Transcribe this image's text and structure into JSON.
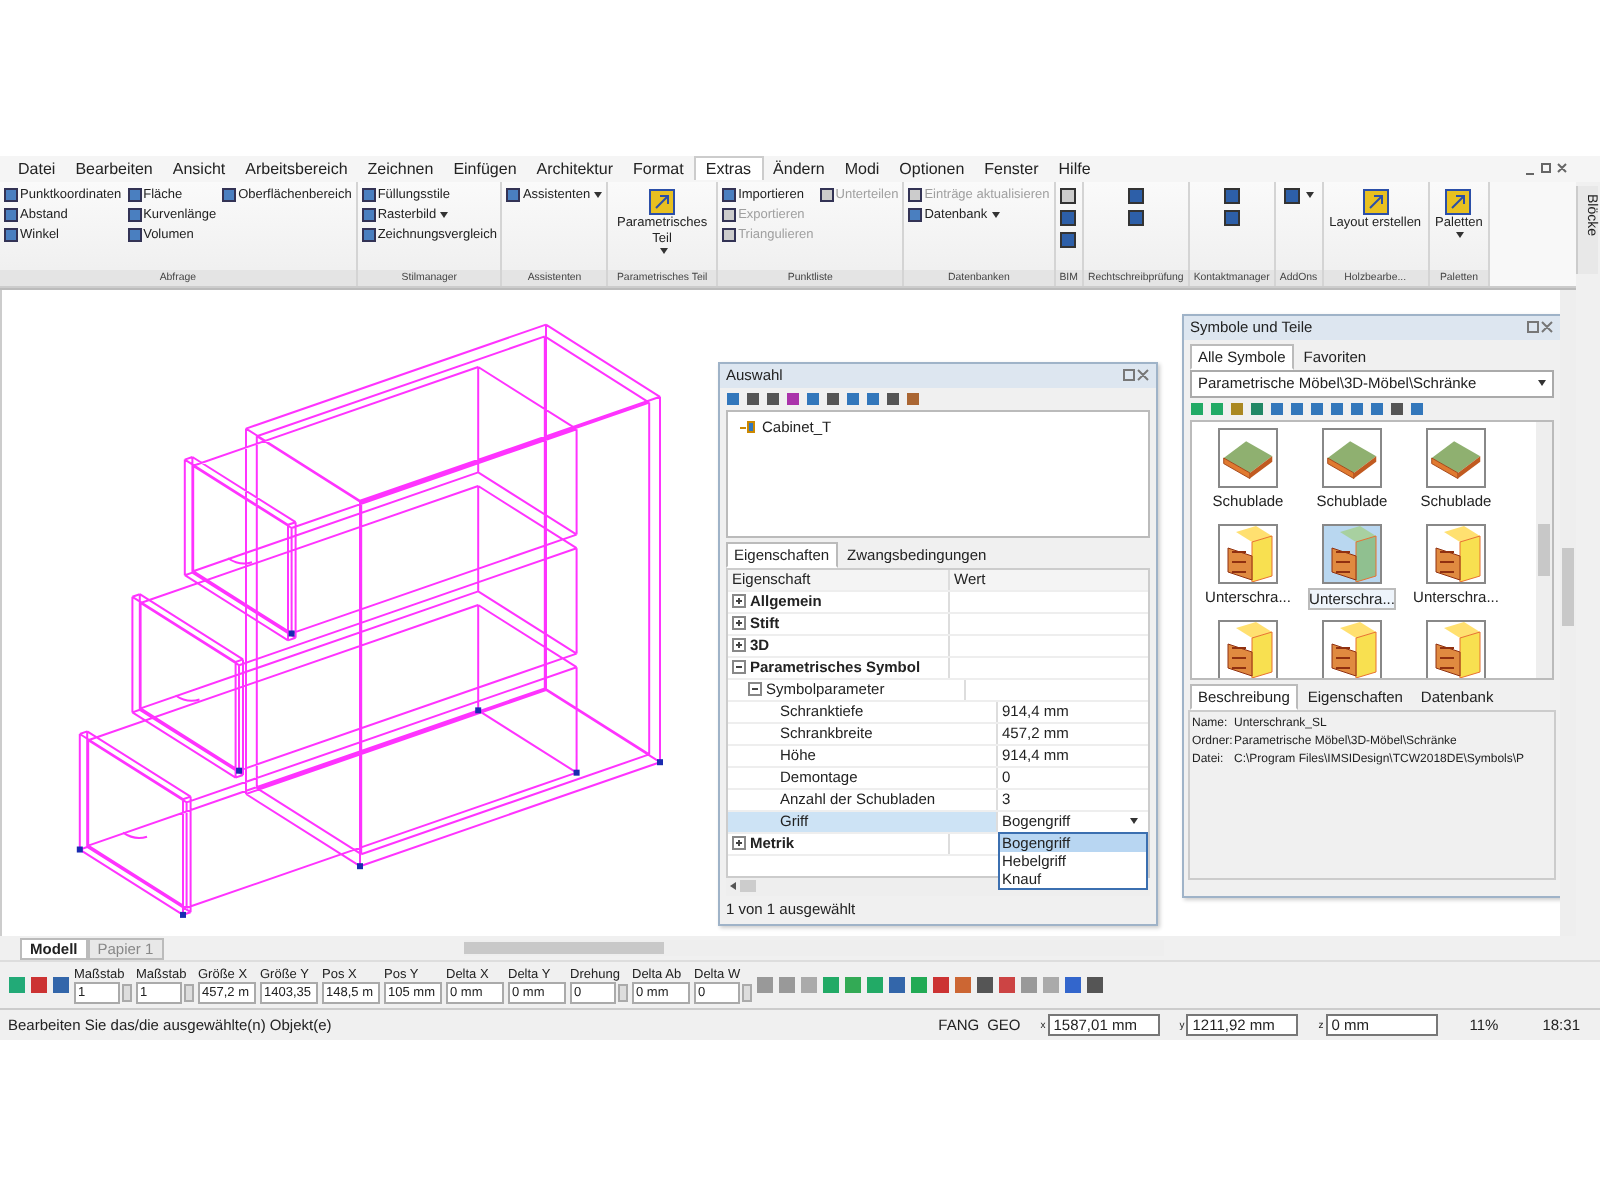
{
  "menu": [
    {
      "label": "Datei",
      "selected": false
    },
    {
      "label": "Bearbeiten",
      "selected": false
    },
    {
      "label": "Ansicht",
      "selected": false
    },
    {
      "label": "Arbeitsbereich",
      "selected": false
    },
    {
      "label": "Zeichnen",
      "selected": false
    },
    {
      "label": "Einfügen",
      "selected": false
    },
    {
      "label": "Architektur",
      "selected": false
    },
    {
      "label": "Format",
      "selected": false
    },
    {
      "label": "Extras",
      "selected": true
    },
    {
      "label": "Ändern",
      "selected": false
    },
    {
      "label": "Modi",
      "selected": false
    },
    {
      "label": "Optionen",
      "selected": false
    },
    {
      "label": "Fenster",
      "selected": false
    },
    {
      "label": "Hilfe",
      "selected": false
    }
  ],
  "ribbon": [
    {
      "label": "Abfrage",
      "kind": "list",
      "items": [
        {
          "label": "Punktkoordinaten",
          "disabled": false
        },
        {
          "label": "Abstand",
          "disabled": false
        },
        {
          "label": "Winkel",
          "disabled": false
        },
        {
          "label": "Fläche",
          "disabled": false
        },
        {
          "label": "Kurvenlänge",
          "disabled": false
        },
        {
          "label": "Volumen",
          "disabled": false
        },
        {
          "label": "Oberflächenbereich",
          "disabled": false
        }
      ]
    },
    {
      "label": "Stilmanager",
      "kind": "list",
      "items": [
        {
          "label": "Füllungsstile",
          "disabled": false
        },
        {
          "label": "Rasterbild",
          "disabled": false,
          "dropdown": true
        },
        {
          "label": "Zeichnungsvergleich",
          "disabled": false
        }
      ]
    },
    {
      "label": "Assistenten",
      "kind": "list",
      "items": [
        {
          "label": "Assistenten",
          "disabled": false,
          "dropdown": true
        }
      ]
    },
    {
      "label": "Parametrisches Teil",
      "kind": "large",
      "items": [
        {
          "label": "Parametrisches Teil",
          "disabled": false,
          "dropdown": true
        }
      ]
    },
    {
      "label": "Punktliste",
      "kind": "list",
      "items": [
        {
          "label": "Importieren",
          "disabled": false
        },
        {
          "label": "Exportieren",
          "disabled": true
        },
        {
          "label": "Triangulieren",
          "disabled": true
        },
        {
          "label": "Unterteilen",
          "disabled": true
        }
      ]
    },
    {
      "label": "Datenbanken",
      "kind": "list",
      "items": [
        {
          "label": "Einträge aktualisieren",
          "disabled": true
        },
        {
          "label": "Datenbank",
          "disabled": false,
          "dropdown": true
        }
      ]
    },
    {
      "label": "BIM",
      "kind": "icons",
      "items": [
        {
          "disabled": true
        },
        {
          "disabled": false
        },
        {
          "disabled": false
        }
      ]
    },
    {
      "label": "Rechtschreibprüfung",
      "kind": "icons",
      "items": [
        {
          "disabled": false
        },
        {
          "disabled": false
        }
      ]
    },
    {
      "label": "Kontaktmanager",
      "kind": "icons",
      "items": [
        {
          "disabled": false
        },
        {
          "disabled": false
        }
      ]
    },
    {
      "label": "AddOns",
      "kind": "icons",
      "items": [
        {
          "disabled": false,
          "dropdown": true
        }
      ]
    },
    {
      "label": "Holzbearbe...",
      "kind": "large",
      "items": [
        {
          "label": "Layout erstellen",
          "disabled": false
        }
      ]
    },
    {
      "label": "Paletten",
      "kind": "large",
      "items": [
        {
          "label": "Paletten",
          "disabled": false,
          "dropdown": true
        }
      ]
    }
  ],
  "side_tab": "Blöcke",
  "selection_panel": {
    "title": "Auswahl",
    "tree_item": "Cabinet_T",
    "tabs": [
      {
        "label": "Eigenschaften",
        "selected": true
      },
      {
        "label": "Zwangsbedingungen",
        "selected": false
      }
    ],
    "columns": [
      "Eigenschaft",
      "Wert"
    ],
    "properties": [
      {
        "label": "Allgemein",
        "expanded": false
      },
      {
        "label": "Stift",
        "expanded": false
      },
      {
        "label": "3D",
        "expanded": false
      },
      {
        "label": "Parametrisches Symbol",
        "expanded": true,
        "children": [
          {
            "label": "Symbolparameter",
            "expanded": true,
            "children": [
              {
                "label": "Schranktiefe",
                "value": "914,4 mm",
                "selected": false
              },
              {
                "label": "Schrankbreite",
                "value": "457,2 mm",
                "selected": false
              },
              {
                "label": "Höhe",
                "value": "914,4 mm",
                "selected": false
              },
              {
                "label": "Demontage",
                "value": "0",
                "selected": false
              },
              {
                "label": "Anzahl der Schubladen",
                "value": "3",
                "selected": false
              },
              {
                "label": "Griff",
                "value": "Bogengriff",
                "selected": true,
                "options": [
                  {
                    "label": "Bogengriff",
                    "selected": true
                  },
                  {
                    "label": "Hebelgriff",
                    "selected": false
                  },
                  {
                    "label": "Knauf",
                    "selected": false
                  }
                ]
              }
            ]
          }
        ]
      },
      {
        "label": "Metrik",
        "expanded": false
      }
    ],
    "footer": "1 von 1 ausgewählt"
  },
  "symbols_panel": {
    "title": "Symbole und Teile",
    "tabs": [
      {
        "label": "Alle Symbole",
        "selected": true
      },
      {
        "label": "Favoriten",
        "selected": false
      }
    ],
    "path": "Parametrische Möbel\\3D-Möbel\\Schränke",
    "items": [
      {
        "kind": "drawer",
        "label": "Schublade",
        "selected": false
      },
      {
        "kind": "drawer",
        "label": "Schublade",
        "selected": false
      },
      {
        "kind": "drawer",
        "label": "Schublade",
        "selected": false
      },
      {
        "kind": "cabinet",
        "label": "Unterschra...",
        "selected": false
      },
      {
        "kind": "cabinet",
        "label": "Unterschra...",
        "selected": true
      },
      {
        "kind": "cabinet",
        "label": "Unterschra...",
        "selected": false
      },
      {
        "kind": "cabinet",
        "selected": false
      },
      {
        "kind": "cabinet",
        "selected": false
      },
      {
        "kind": "cabinet",
        "selected": false
      }
    ],
    "info_tabs": [
      {
        "label": "Beschreibung",
        "selected": true
      },
      {
        "label": "Eigenschaften",
        "selected": false
      },
      {
        "label": "Datenbank",
        "selected": false
      }
    ],
    "info": [
      {
        "label": "Name:",
        "value": "Unterschrank_SL"
      },
      {
        "label": "Ordner:",
        "value": "Parametrische Möbel\\3D-Möbel\\Schränke"
      },
      {
        "label": "Datei:",
        "value": "C:\\Program Files\\IMSIDesign\\TCW2018DE\\Symbols\\P"
      }
    ]
  },
  "sheets": [
    {
      "label": "Modell",
      "selected": true
    },
    {
      "label": "Papier 1",
      "selected": false
    }
  ],
  "fields": [
    {
      "label": "Maßstab",
      "value": "1",
      "spinner": true
    },
    {
      "label": "Maßstab",
      "value": "1",
      "spinner": true
    },
    {
      "label": "Größe X",
      "value": "457,2 m",
      "spinner": false
    },
    {
      "label": "Größe Y",
      "value": "1403,35",
      "spinner": false
    },
    {
      "label": "Pos X",
      "value": "148,5 m",
      "spinner": false
    },
    {
      "label": "Pos Y",
      "value": "105 mm",
      "spinner": false
    },
    {
      "label": "Delta X",
      "value": "0 mm",
      "spinner": false
    },
    {
      "label": "Delta Y",
      "value": "0 mm",
      "spinner": false
    },
    {
      "label": "Drehung",
      "value": "0",
      "spinner": true
    },
    {
      "label": "Delta Ab",
      "value": "0 mm",
      "spinner": false
    },
    {
      "label": "Delta W",
      "value": "0",
      "spinner": true
    }
  ],
  "status_bar": {
    "message": "Bearbeiten Sie das/die ausgewählte(n) Objekt(e)",
    "modes": [
      "FANG",
      "GEO"
    ],
    "coords": [
      {
        "axis": "x",
        "value": "1587,01 mm"
      },
      {
        "axis": "y",
        "value": "1211,92 mm"
      },
      {
        "axis": "z",
        "value": "0 mm"
      }
    ],
    "zoom": "11%",
    "time": "18:31"
  }
}
